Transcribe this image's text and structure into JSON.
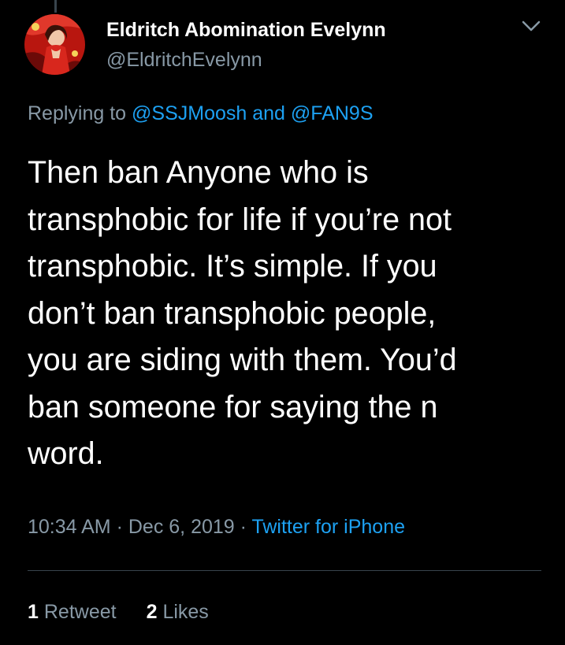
{
  "author": {
    "display_name": "Eldritch Abomination Evelynn",
    "handle": "@EldritchEvelynn",
    "avatar_icon": "profile-avatar"
  },
  "reply": {
    "prefix": "Replying to",
    "mention_1": "@SSJMoosh",
    "conjunction": "and",
    "mention_2": "@FAN9S"
  },
  "tweet": {
    "lines": [
      "Then ban Anyone who is",
      "transphobic for life if you’re not",
      "transphobic. It’s simple. If you",
      "don’t ban transphobic people,",
      "you are siding with them. You’d",
      "ban someone for saying the n",
      "word."
    ]
  },
  "meta": {
    "time": "10:34 AM",
    "separator": "·",
    "date": "Dec 6, 2019",
    "source": "Twitter for iPhone"
  },
  "stats": {
    "retweets_count": "1",
    "retweets_label": "Retweet",
    "likes_count": "2",
    "likes_label": "Likes"
  },
  "colors": {
    "background": "#000000",
    "text_primary": "#ffffff",
    "text_secondary": "#8899a6",
    "accent": "#1da1f2",
    "divider": "#38444d"
  },
  "icons": {
    "more": "chevron-down-icon"
  }
}
